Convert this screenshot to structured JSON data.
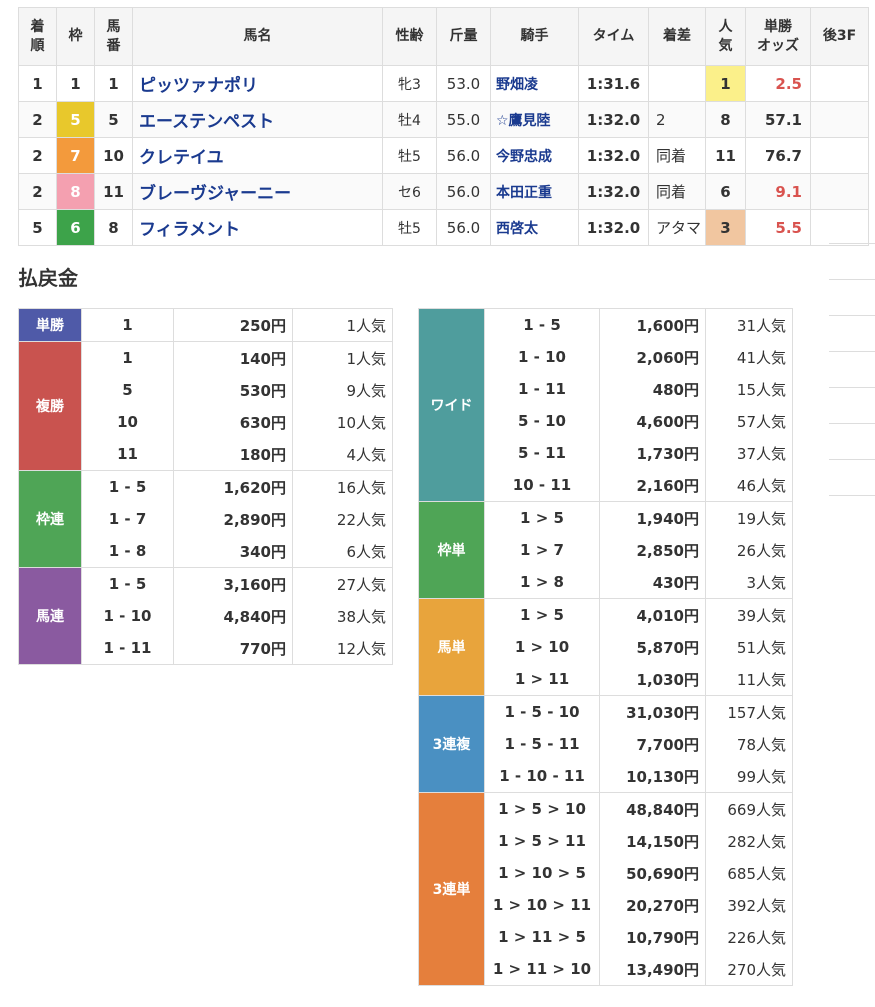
{
  "results": {
    "headers": {
      "rank": [
        "着",
        "順"
      ],
      "waku": "枠",
      "umaban": [
        "馬",
        "番"
      ],
      "name": "馬名",
      "sexage": "性齢",
      "weight": "斤量",
      "jockey": "騎手",
      "time": "タイム",
      "margin": "着差",
      "popularity": [
        "人",
        "気"
      ],
      "odds": [
        "単勝",
        "オッズ"
      ],
      "last3f": "後3F"
    },
    "rows": [
      {
        "rank": "1",
        "waku": "1",
        "waku_color": "#ffffff",
        "waku_text": "#333333",
        "umaban": "1",
        "name": "ピッツァナポリ",
        "sexage": "牝3",
        "weight": "53.0",
        "jockey": "野畑凌",
        "time": "1:31.6",
        "margin": "",
        "popularity": "1",
        "odds": "2.5",
        "odds_hot": true
      },
      {
        "rank": "2",
        "waku": "5",
        "waku_color": "#e8c82c",
        "waku_text": "#ffffff",
        "umaban": "5",
        "name": "エーステンペスト",
        "sexage": "牡4",
        "weight": "55.0",
        "jockey": "☆鷹見陸",
        "time": "1:32.0",
        "margin": "2",
        "popularity": "8",
        "odds": "57.1",
        "odds_hot": false
      },
      {
        "rank": "2",
        "waku": "7",
        "waku_color": "#f39a3c",
        "waku_text": "#ffffff",
        "umaban": "10",
        "name": "クレテイユ",
        "sexage": "牡5",
        "weight": "56.0",
        "jockey": "今野忠成",
        "time": "1:32.0",
        "margin": "同着",
        "popularity": "11",
        "odds": "76.7",
        "odds_hot": false
      },
      {
        "rank": "2",
        "waku": "8",
        "waku_color": "#f4a0b0",
        "waku_text": "#ffffff",
        "umaban": "11",
        "name": "ブレーヴジャーニー",
        "sexage": "セ6",
        "weight": "56.0",
        "jockey": "本田正重",
        "time": "1:32.0",
        "margin": "同着",
        "popularity": "6",
        "odds": "9.1",
        "odds_hot": true
      },
      {
        "rank": "5",
        "waku": "6",
        "waku_color": "#3da34a",
        "waku_text": "#ffffff",
        "umaban": "8",
        "name": "フィラメント",
        "sexage": "牡5",
        "weight": "56.0",
        "jockey": "西啓太",
        "time": "1:32.0",
        "margin": "アタマ",
        "popularity": "3",
        "odds": "5.5",
        "odds_hot": true
      }
    ]
  },
  "payout": {
    "title": "払戻金",
    "left": [
      {
        "label": "単勝",
        "color": "#4f5aa8",
        "rows": [
          {
            "combo": "1",
            "amount": "250円",
            "pop": "1人気"
          }
        ]
      },
      {
        "label": "複勝",
        "color": "#c9534f",
        "rows": [
          {
            "combo": "1",
            "amount": "140円",
            "pop": "1人気"
          },
          {
            "combo": "5",
            "amount": "530円",
            "pop": "9人気"
          },
          {
            "combo": "10",
            "amount": "630円",
            "pop": "10人気"
          },
          {
            "combo": "11",
            "amount": "180円",
            "pop": "4人気"
          }
        ]
      },
      {
        "label": "枠連",
        "color": "#4fa556",
        "rows": [
          {
            "combo": "1 - 5",
            "amount": "1,620円",
            "pop": "16人気"
          },
          {
            "combo": "1 - 7",
            "amount": "2,890円",
            "pop": "22人気"
          },
          {
            "combo": "1 - 8",
            "amount": "340円",
            "pop": "6人気"
          }
        ]
      },
      {
        "label": "馬連",
        "color": "#8a5aa0",
        "rows": [
          {
            "combo": "1 - 5",
            "amount": "3,160円",
            "pop": "27人気"
          },
          {
            "combo": "1 - 10",
            "amount": "4,840円",
            "pop": "38人気"
          },
          {
            "combo": "1 - 11",
            "amount": "770円",
            "pop": "12人気"
          }
        ]
      }
    ],
    "right": [
      {
        "label": "ワイド",
        "color": "#4f9d9d",
        "rows": [
          {
            "combo": "1 - 5",
            "amount": "1,600円",
            "pop": "31人気"
          },
          {
            "combo": "1 - 10",
            "amount": "2,060円",
            "pop": "41人気"
          },
          {
            "combo": "1 - 11",
            "amount": "480円",
            "pop": "15人気"
          },
          {
            "combo": "5 - 10",
            "amount": "4,600円",
            "pop": "57人気"
          },
          {
            "combo": "5 - 11",
            "amount": "1,730円",
            "pop": "37人気"
          },
          {
            "combo": "10 - 11",
            "amount": "2,160円",
            "pop": "46人気"
          }
        ]
      },
      {
        "label": "枠単",
        "color": "#4fa556",
        "rows": [
          {
            "combo": "1 > 5",
            "amount": "1,940円",
            "pop": "19人気"
          },
          {
            "combo": "1 > 7",
            "amount": "2,850円",
            "pop": "26人気"
          },
          {
            "combo": "1 > 8",
            "amount": "430円",
            "pop": "3人気"
          }
        ]
      },
      {
        "label": "馬単",
        "color": "#e8a43c",
        "rows": [
          {
            "combo": "1 > 5",
            "amount": "4,010円",
            "pop": "39人気"
          },
          {
            "combo": "1 > 10",
            "amount": "5,870円",
            "pop": "51人気"
          },
          {
            "combo": "1 > 11",
            "amount": "1,030円",
            "pop": "11人気"
          }
        ]
      },
      {
        "label": "3連複",
        "color": "#4a90c2",
        "rows": [
          {
            "combo": "1 - 5 - 10",
            "amount": "31,030円",
            "pop": "157人気"
          },
          {
            "combo": "1 - 5 - 11",
            "amount": "7,700円",
            "pop": "78人気"
          },
          {
            "combo": "1 - 10 - 11",
            "amount": "10,130円",
            "pop": "99人気"
          }
        ]
      },
      {
        "label": "3連単",
        "color": "#e57f3c",
        "rows": [
          {
            "combo": "1 > 5 > 10",
            "amount": "48,840円",
            "pop": "669人気"
          },
          {
            "combo": "1 > 5 > 11",
            "amount": "14,150円",
            "pop": "282人気"
          },
          {
            "combo": "1 > 10 > 5",
            "amount": "50,690円",
            "pop": "685人気"
          },
          {
            "combo": "1 > 10 > 11",
            "amount": "20,270円",
            "pop": "392人気"
          },
          {
            "combo": "1 > 11 > 5",
            "amount": "10,790円",
            "pop": "226人気"
          },
          {
            "combo": "1 > 11 > 10",
            "amount": "13,490円",
            "pop": "270人気"
          }
        ]
      }
    ]
  }
}
